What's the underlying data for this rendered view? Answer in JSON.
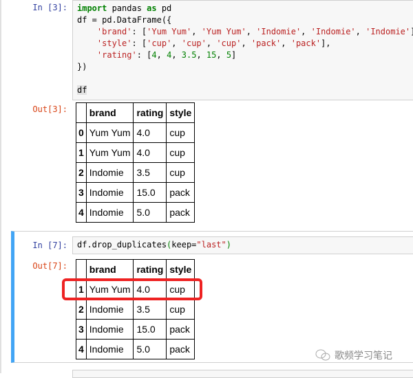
{
  "cells": [
    {
      "in_prompt": "In  [3]:",
      "code_lines": [
        [
          {
            "t": "import",
            "c": "kw"
          },
          {
            "t": " pandas "
          },
          {
            "t": "as",
            "c": "kw"
          },
          {
            "t": " pd"
          }
        ],
        [
          {
            "t": "df = pd.DataFrame({"
          }
        ],
        [
          {
            "t": "    "
          },
          {
            "t": "'brand'",
            "c": "str"
          },
          {
            "t": ": ["
          },
          {
            "t": "'Yum Yum'",
            "c": "str"
          },
          {
            "t": ", "
          },
          {
            "t": "'Yum Yum'",
            "c": "str"
          },
          {
            "t": ", "
          },
          {
            "t": "'Indomie'",
            "c": "str"
          },
          {
            "t": ", "
          },
          {
            "t": "'Indomie'",
            "c": "str"
          },
          {
            "t": ", "
          },
          {
            "t": "'Indomie'",
            "c": "str"
          },
          {
            "t": "],"
          }
        ],
        [
          {
            "t": "    "
          },
          {
            "t": "'style'",
            "c": "str"
          },
          {
            "t": ": ["
          },
          {
            "t": "'cup'",
            "c": "str"
          },
          {
            "t": ", "
          },
          {
            "t": "'cup'",
            "c": "str"
          },
          {
            "t": ", "
          },
          {
            "t": "'cup'",
            "c": "str"
          },
          {
            "t": ", "
          },
          {
            "t": "'pack'",
            "c": "str"
          },
          {
            "t": ", "
          },
          {
            "t": "'pack'",
            "c": "str"
          },
          {
            "t": "],"
          }
        ],
        [
          {
            "t": "    "
          },
          {
            "t": "'rating'",
            "c": "str"
          },
          {
            "t": ": ["
          },
          {
            "t": "4",
            "c": "num"
          },
          {
            "t": ", "
          },
          {
            "t": "4",
            "c": "num"
          },
          {
            "t": ", "
          },
          {
            "t": "3.5",
            "c": "num"
          },
          {
            "t": ", "
          },
          {
            "t": "15",
            "c": "num"
          },
          {
            "t": ", "
          },
          {
            "t": "5",
            "c": "num"
          },
          {
            "t": "]"
          }
        ],
        [
          {
            "t": "})"
          }
        ],
        [
          {
            "t": ""
          }
        ],
        [
          {
            "t": "df",
            "c": "hl"
          }
        ]
      ],
      "out_prompt": "Out[3]:",
      "table": {
        "columns": [
          "",
          "brand",
          "rating",
          "style"
        ],
        "rows": [
          [
            "0",
            "Yum Yum",
            "4.0",
            "cup"
          ],
          [
            "1",
            "Yum Yum",
            "4.0",
            "cup"
          ],
          [
            "2",
            "Indomie",
            "3.5",
            "cup"
          ],
          [
            "3",
            "Indomie",
            "15.0",
            "pack"
          ],
          [
            "4",
            "Indomie",
            "5.0",
            "pack"
          ]
        ]
      }
    },
    {
      "in_prompt": "In  [7]:",
      "code_lines": [
        [
          {
            "t": "df.drop_duplicates"
          },
          {
            "t": "(",
            "c": "par"
          },
          {
            "t": "keep="
          },
          {
            "t": "\"last\"",
            "c": "str"
          },
          {
            "t": ")",
            "c": "par"
          }
        ]
      ],
      "out_prompt": "Out[7]:",
      "table": {
        "columns": [
          "",
          "brand",
          "rating",
          "style"
        ],
        "rows": [
          [
            "1",
            "Yum Yum",
            "4.0",
            "cup"
          ],
          [
            "2",
            "Indomie",
            "3.5",
            "cup"
          ],
          [
            "3",
            "Indomie",
            "15.0",
            "pack"
          ],
          [
            "4",
            "Indomie",
            "5.0",
            "pack"
          ]
        ],
        "highlighted_row": "1"
      }
    }
  ],
  "watermark": {
    "text": "歌频学习笔记",
    "icon": "wechat-icon"
  },
  "colors": {
    "in_prompt": "#303f9f",
    "out_prompt": "#d84315",
    "selected_cell_bar": "#42a5f5",
    "highlight_box": "#ee2222"
  }
}
